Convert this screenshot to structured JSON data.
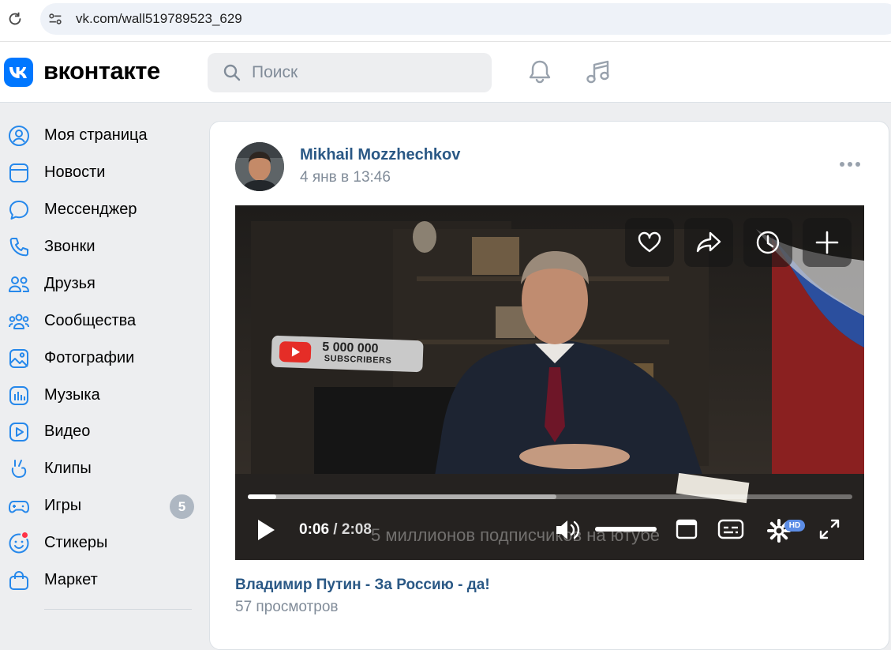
{
  "browser": {
    "url": "vk.com/wall519789523_629"
  },
  "header": {
    "logo_text": "вконтакте",
    "search_placeholder": "Поиск"
  },
  "sidebar": {
    "items": [
      {
        "label": "Моя страница",
        "icon": "user-circle-icon"
      },
      {
        "label": "Новости",
        "icon": "news-icon"
      },
      {
        "label": "Мессенджер",
        "icon": "message-icon"
      },
      {
        "label": "Звонки",
        "icon": "phone-icon"
      },
      {
        "label": "Друзья",
        "icon": "friends-icon"
      },
      {
        "label": "Сообщества",
        "icon": "communities-icon"
      },
      {
        "label": "Фотографии",
        "icon": "photo-icon"
      },
      {
        "label": "Музыка",
        "icon": "music-icon"
      },
      {
        "label": "Видео",
        "icon": "video-icon"
      },
      {
        "label": "Клипы",
        "icon": "clips-icon"
      },
      {
        "label": "Игры",
        "icon": "games-icon",
        "badge": "5"
      },
      {
        "label": "Стикеры",
        "icon": "stickers-icon"
      },
      {
        "label": "Маркет",
        "icon": "market-icon"
      }
    ]
  },
  "post": {
    "author": "Mikhail Mozzhechkov",
    "date": "4 янв в 13:46",
    "video": {
      "badge_count": "5 000 000",
      "badge_label": "SUBSCRIBERS",
      "current_time": "0:06",
      "separator": " / ",
      "duration": "2:08",
      "progress": 0.047,
      "buffered": 0.51,
      "volume": 1.0,
      "subtitle": "5 миллионов подписчиков на ютубе",
      "quality_badge": "HD"
    },
    "video_title": "Владимир Путин - За Россию - да!",
    "views": "57 просмотров"
  },
  "colors": {
    "vk_blue": "#0077ff",
    "link_blue": "#2a5885",
    "muted_gray": "#818c99",
    "badge_gray": "#aeb7c2",
    "page_bg": "#edeef0"
  }
}
